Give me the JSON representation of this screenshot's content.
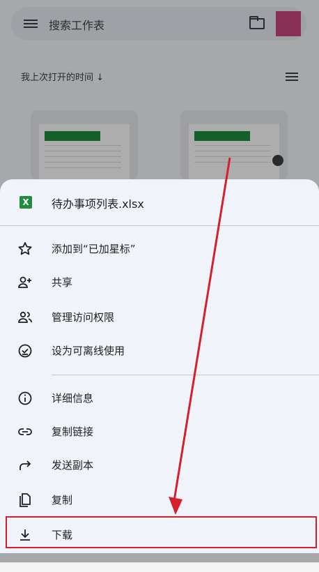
{
  "search": {
    "placeholder": "搜索工作表"
  },
  "sort": {
    "label": "我上次打开的时间 ↓"
  },
  "sheet": {
    "file_name": "待办事项列表.xlsx",
    "file_icon_letter": "X",
    "items_group1": [
      {
        "label": "添加到“已加星标”",
        "icon": "star-icon"
      },
      {
        "label": "共享",
        "icon": "person-add-icon"
      },
      {
        "label": "管理访问权限",
        "icon": "people-icon"
      },
      {
        "label": "设为可离线使用",
        "icon": "offline-check-icon"
      }
    ],
    "items_group2": [
      {
        "label": "详细信息",
        "icon": "info-icon"
      },
      {
        "label": "复制链接",
        "icon": "link-icon"
      },
      {
        "label": "发送副本",
        "icon": "share-arrow-icon"
      },
      {
        "label": "复制",
        "icon": "copy-icon"
      },
      {
        "label": "下载",
        "icon": "download-icon"
      }
    ]
  },
  "colors": {
    "accent_red": "#d61f2c",
    "excel_green": "#1e8e3e"
  }
}
